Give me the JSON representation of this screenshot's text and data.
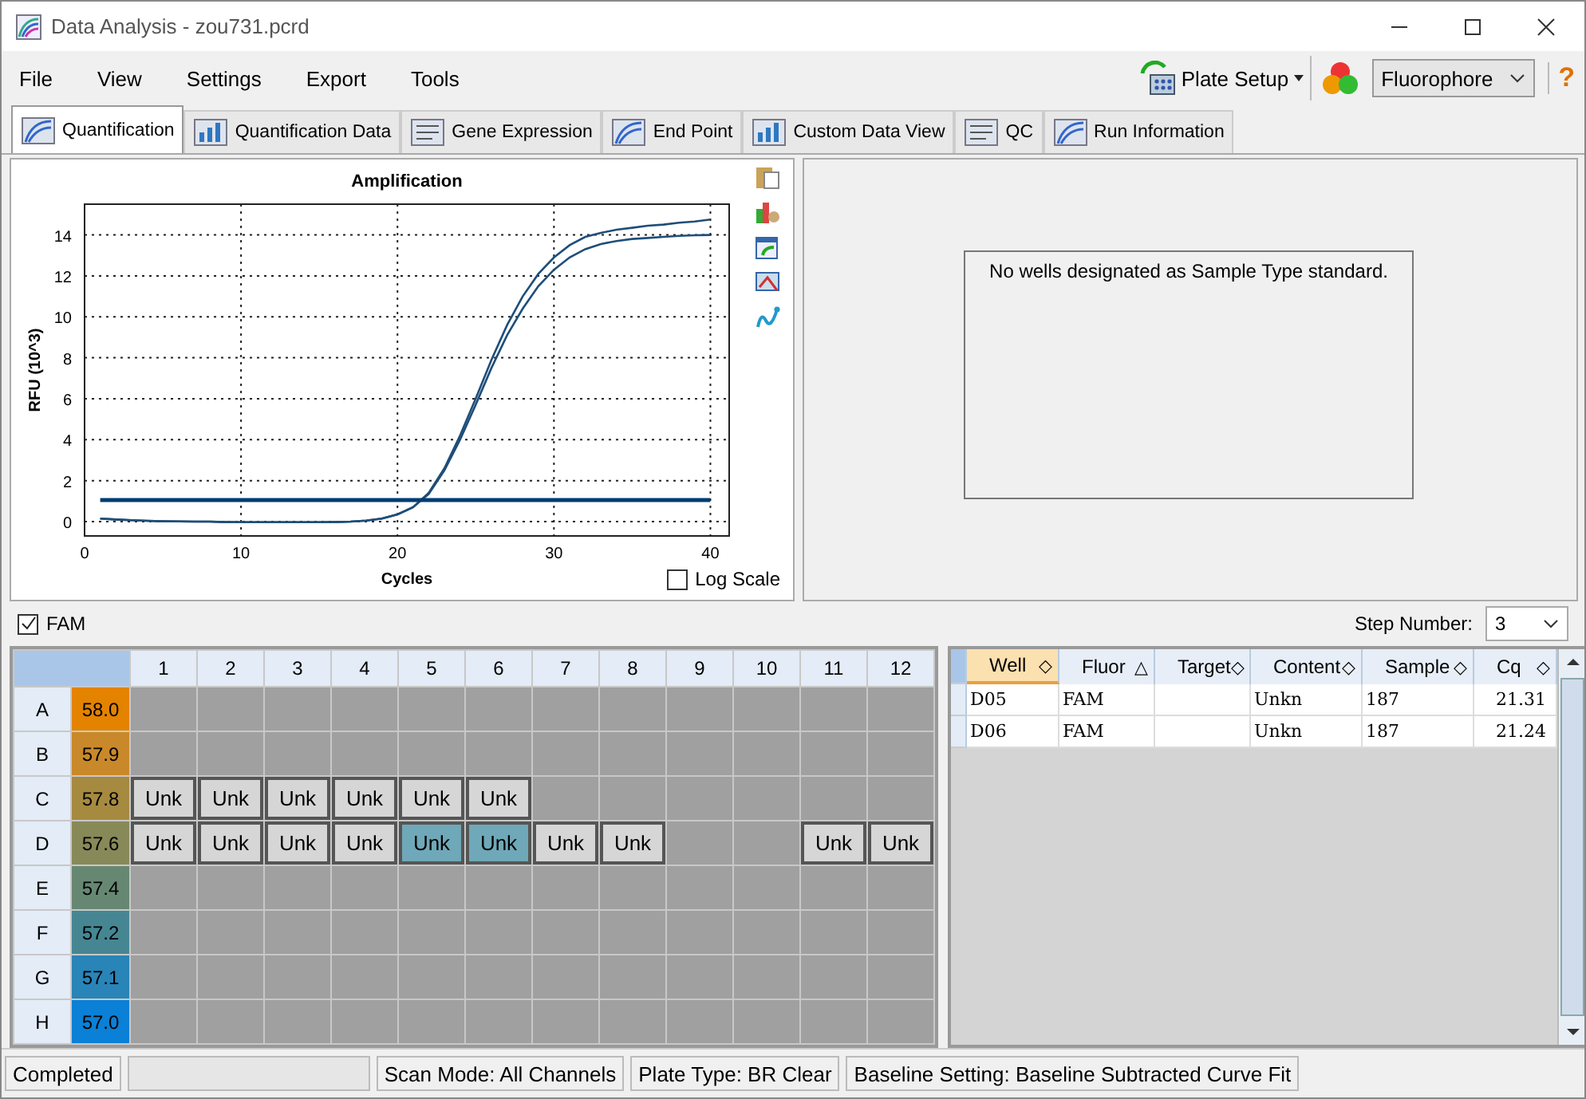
{
  "window": {
    "title": "Data Analysis - zou731.pcrd"
  },
  "menu": [
    "File",
    "View",
    "Settings",
    "Export",
    "Tools"
  ],
  "toolbar": {
    "plate_setup": "Plate Setup",
    "fluorophore": "Fluorophore",
    "help": "?"
  },
  "tabs": [
    {
      "label": "Quantification",
      "selected": true
    },
    {
      "label": "Quantification Data",
      "selected": false
    },
    {
      "label": "Gene Expression",
      "selected": false
    },
    {
      "label": "End Point",
      "selected": false
    },
    {
      "label": "Custom Data View",
      "selected": false
    },
    {
      "label": "QC",
      "selected": false
    },
    {
      "label": "Run Information",
      "selected": false
    }
  ],
  "amplification": {
    "log_scale": {
      "label": "Log Scale",
      "checked": false
    },
    "chart_data": {
      "type": "line",
      "title": "Amplification",
      "xlabel": "Cycles",
      "ylabel": "RFU (10^3)",
      "xlim": [
        0,
        41.2
      ],
      "ylim": [
        -0.7,
        15.5
      ],
      "grid": true,
      "xticks": [
        {
          "value": 0,
          "label": "0"
        },
        {
          "value": 10,
          "label": "10"
        },
        {
          "value": 20,
          "label": "20"
        },
        {
          "value": 30,
          "label": "30"
        },
        {
          "value": 40,
          "label": "40"
        }
      ],
      "yticks": [
        {
          "value": 0,
          "label": "0"
        },
        {
          "value": 2,
          "label": "2"
        },
        {
          "value": 4,
          "label": "4"
        },
        {
          "value": 6,
          "label": "6"
        },
        {
          "value": 8,
          "label": "8"
        },
        {
          "value": 10,
          "label": "10"
        },
        {
          "value": 12,
          "label": "12"
        },
        {
          "value": 14,
          "label": "14"
        }
      ],
      "x": [
        1,
        2,
        3,
        4,
        5,
        6,
        7,
        8,
        9,
        10,
        11,
        12,
        13,
        14,
        15,
        16,
        17,
        18,
        19,
        20,
        21,
        22,
        23,
        24,
        25,
        26,
        27,
        28,
        29,
        30,
        31,
        32,
        33,
        34,
        35,
        36,
        37,
        38,
        39,
        40
      ],
      "series": [
        {
          "color": "#1f4e79",
          "values": [
            0.15,
            0.1,
            0.07,
            0.04,
            0.02,
            0.01,
            0,
            0,
            -0.02,
            -0.03,
            -0.03,
            -0.03,
            -0.03,
            -0.03,
            -0.03,
            -0.02,
            0,
            0.05,
            0.15,
            0.35,
            0.7,
            1.4,
            2.6,
            4.2,
            6.0,
            7.9,
            9.6,
            11.0,
            12.1,
            12.9,
            13.5,
            13.9,
            14.1,
            14.25,
            14.35,
            14.45,
            14.5,
            14.6,
            14.65,
            14.75
          ]
        },
        {
          "color": "#1f4e79",
          "values": [
            0.15,
            0.1,
            0.07,
            0.04,
            0.02,
            0.01,
            0,
            0,
            -0.02,
            -0.03,
            -0.03,
            -0.03,
            -0.03,
            -0.03,
            -0.03,
            -0.02,
            0,
            0.05,
            0.15,
            0.35,
            0.7,
            1.35,
            2.5,
            4.0,
            5.7,
            7.5,
            9.1,
            10.4,
            11.5,
            12.3,
            12.9,
            13.3,
            13.55,
            13.7,
            13.8,
            13.85,
            13.9,
            13.95,
            13.98,
            14.0
          ]
        },
        {
          "color": "#003c71",
          "values": [
            1.05,
            1.05,
            1.05,
            1.05,
            1.05,
            1.05,
            1.05,
            1.05,
            1.05,
            1.05,
            1.05,
            1.05,
            1.05,
            1.05,
            1.05,
            1.05,
            1.05,
            1.05,
            1.05,
            1.05,
            1.05,
            1.05,
            1.05,
            1.05,
            1.05,
            1.05,
            1.05,
            1.05,
            1.05,
            1.05,
            1.05,
            1.05,
            1.05,
            1.05,
            1.05,
            1.05,
            1.05,
            1.05,
            1.05,
            1.05
          ]
        }
      ]
    }
  },
  "standard_curve": {
    "message": "No wells designated as Sample Type standard."
  },
  "fluor_filter": {
    "label": "FAM",
    "checked": true
  },
  "step_number": {
    "label": "Step Number:",
    "value": "3"
  },
  "plate": {
    "columns": [
      "1",
      "2",
      "3",
      "4",
      "5",
      "6",
      "7",
      "8",
      "9",
      "10",
      "11",
      "12"
    ],
    "rows": [
      {
        "label": "A",
        "temp": "58.0",
        "color": "#e38300",
        "wells": [
          {
            "kind": "empty"
          },
          {
            "kind": "empty"
          },
          {
            "kind": "empty"
          },
          {
            "kind": "empty"
          },
          {
            "kind": "empty"
          },
          {
            "kind": "empty"
          },
          {
            "kind": "empty"
          },
          {
            "kind": "empty"
          },
          {
            "kind": "empty"
          },
          {
            "kind": "empty"
          },
          {
            "kind": "empty"
          },
          {
            "kind": "empty"
          }
        ]
      },
      {
        "label": "B",
        "temp": "57.9",
        "color": "#c9892a",
        "wells": [
          {
            "kind": "empty"
          },
          {
            "kind": "empty"
          },
          {
            "kind": "empty"
          },
          {
            "kind": "empty"
          },
          {
            "kind": "empty"
          },
          {
            "kind": "empty"
          },
          {
            "kind": "empty"
          },
          {
            "kind": "empty"
          },
          {
            "kind": "empty"
          },
          {
            "kind": "empty"
          },
          {
            "kind": "empty"
          },
          {
            "kind": "empty"
          }
        ]
      },
      {
        "label": "C",
        "temp": "57.8",
        "color": "#a68a40",
        "wells": [
          {
            "kind": "sample",
            "label": "Unk",
            "selected": false
          },
          {
            "kind": "sample",
            "label": "Unk",
            "selected": false
          },
          {
            "kind": "sample",
            "label": "Unk",
            "selected": false
          },
          {
            "kind": "sample",
            "label": "Unk",
            "selected": false
          },
          {
            "kind": "sample",
            "label": "Unk",
            "selected": false
          },
          {
            "kind": "sample",
            "label": "Unk",
            "selected": false
          },
          {
            "kind": "empty"
          },
          {
            "kind": "empty"
          },
          {
            "kind": "empty"
          },
          {
            "kind": "empty"
          },
          {
            "kind": "empty"
          },
          {
            "kind": "empty"
          }
        ]
      },
      {
        "label": "D",
        "temp": "57.6",
        "color": "#878a58",
        "wells": [
          {
            "kind": "sample",
            "label": "Unk",
            "selected": false
          },
          {
            "kind": "sample",
            "label": "Unk",
            "selected": false
          },
          {
            "kind": "sample",
            "label": "Unk",
            "selected": false
          },
          {
            "kind": "sample",
            "label": "Unk",
            "selected": false
          },
          {
            "kind": "sample",
            "label": "Unk",
            "selected": true
          },
          {
            "kind": "sample",
            "label": "Unk",
            "selected": true
          },
          {
            "kind": "sample",
            "label": "Unk",
            "selected": false
          },
          {
            "kind": "sample",
            "label": "Unk",
            "selected": false
          },
          {
            "kind": "empty"
          },
          {
            "kind": "empty"
          },
          {
            "kind": "sample",
            "label": "Unk",
            "selected": false
          },
          {
            "kind": "sample",
            "label": "Unk",
            "selected": false
          }
        ]
      },
      {
        "label": "E",
        "temp": "57.4",
        "color": "#668872",
        "wells": [
          {
            "kind": "empty"
          },
          {
            "kind": "empty"
          },
          {
            "kind": "empty"
          },
          {
            "kind": "empty"
          },
          {
            "kind": "empty"
          },
          {
            "kind": "empty"
          },
          {
            "kind": "empty"
          },
          {
            "kind": "empty"
          },
          {
            "kind": "empty"
          },
          {
            "kind": "empty"
          },
          {
            "kind": "empty"
          },
          {
            "kind": "empty"
          }
        ]
      },
      {
        "label": "F",
        "temp": "57.2",
        "color": "#468693",
        "wells": [
          {
            "kind": "empty"
          },
          {
            "kind": "empty"
          },
          {
            "kind": "empty"
          },
          {
            "kind": "empty"
          },
          {
            "kind": "empty"
          },
          {
            "kind": "empty"
          },
          {
            "kind": "empty"
          },
          {
            "kind": "empty"
          },
          {
            "kind": "empty"
          },
          {
            "kind": "empty"
          },
          {
            "kind": "empty"
          },
          {
            "kind": "empty"
          }
        ]
      },
      {
        "label": "G",
        "temp": "57.1",
        "color": "#2984b8",
        "wells": [
          {
            "kind": "empty"
          },
          {
            "kind": "empty"
          },
          {
            "kind": "empty"
          },
          {
            "kind": "empty"
          },
          {
            "kind": "empty"
          },
          {
            "kind": "empty"
          },
          {
            "kind": "empty"
          },
          {
            "kind": "empty"
          },
          {
            "kind": "empty"
          },
          {
            "kind": "empty"
          },
          {
            "kind": "empty"
          },
          {
            "kind": "empty"
          }
        ]
      },
      {
        "label": "H",
        "temp": "57.0",
        "color": "#0a80d6",
        "wells": [
          {
            "kind": "empty"
          },
          {
            "kind": "empty"
          },
          {
            "kind": "empty"
          },
          {
            "kind": "empty"
          },
          {
            "kind": "empty"
          },
          {
            "kind": "empty"
          },
          {
            "kind": "empty"
          },
          {
            "kind": "empty"
          },
          {
            "kind": "empty"
          },
          {
            "kind": "empty"
          },
          {
            "kind": "empty"
          },
          {
            "kind": "empty"
          }
        ]
      }
    ]
  },
  "results": {
    "columns": [
      {
        "label": "Well",
        "sort_icon": "◇",
        "selected": true
      },
      {
        "label": "Fluor",
        "sort_icon": "△",
        "selected": false
      },
      {
        "label": "Target",
        "sort_icon": "◇",
        "selected": false
      },
      {
        "label": "Content",
        "sort_icon": "◇",
        "selected": false
      },
      {
        "label": "Sample",
        "sort_icon": "◇",
        "selected": false
      },
      {
        "label": "Cq",
        "sort_icon": "◇",
        "selected": false
      }
    ],
    "rows": [
      [
        "D05",
        "FAM",
        "",
        "Unkn",
        "187",
        "21.31"
      ],
      [
        "D06",
        "FAM",
        "",
        "Unkn",
        "187",
        "21.24"
      ]
    ]
  },
  "status_bar": {
    "status": "Completed",
    "progress": {
      "level": 0
    },
    "items": [
      "Scan Mode: All Channels",
      "Plate Type: BR Clear",
      "Baseline Setting: Baseline Subtracted Curve Fit"
    ]
  }
}
